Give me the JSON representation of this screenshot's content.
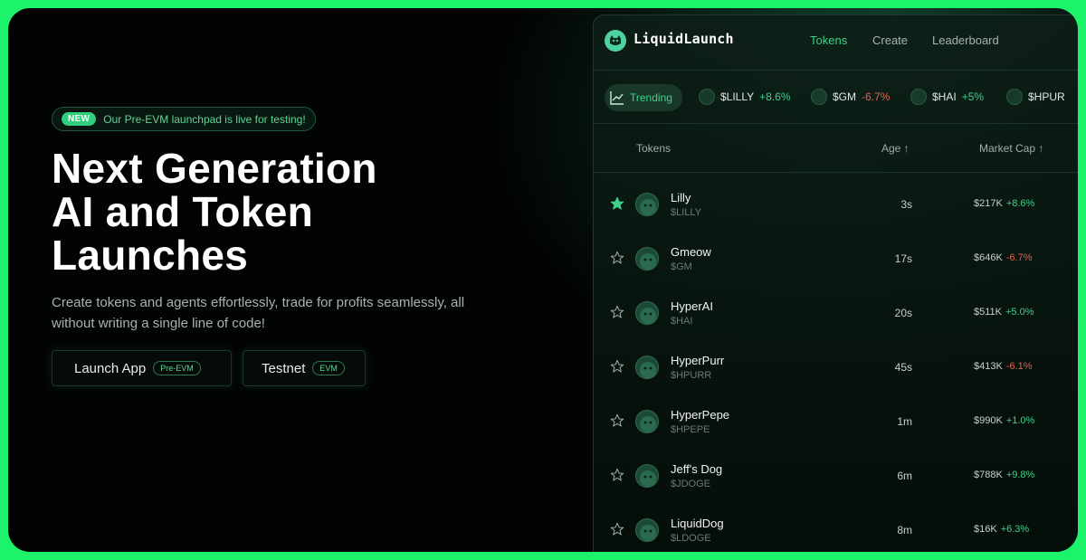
{
  "hero": {
    "badge_tag": "NEW",
    "badge_text": "Our Pre-EVM launchpad is live for testing!",
    "title_lines": [
      "Next Generation",
      "AI and Token",
      "Launches"
    ],
    "subtitle": "Create tokens and agents effortlessly, trade for profits seamlessly, all without writing a single line of code!",
    "launch_button": "Launch App",
    "launch_pill": "Pre-EVM",
    "testnet_button": "Testnet",
    "testnet_pill": "EVM"
  },
  "app": {
    "logo_text": "LiquidLaunch",
    "nav": [
      {
        "label": "Tokens",
        "active": true
      },
      {
        "label": "Create",
        "active": false
      },
      {
        "label": "Leaderboard",
        "active": false
      }
    ],
    "trending_label": "Trending",
    "ticker": [
      {
        "symbol": "$LILLY",
        "change": "+8.6%",
        "dir": "up"
      },
      {
        "symbol": "$GM",
        "change": "-6.7%",
        "dir": "down"
      },
      {
        "symbol": "$HAI",
        "change": "+5%",
        "dir": "up"
      },
      {
        "symbol": "$HPUR",
        "change": "",
        "dir": "up"
      }
    ],
    "table_headers": {
      "tokens": "Tokens",
      "age": "Age ↑",
      "market_cap": "Market Cap ↑"
    },
    "rows": [
      {
        "name": "Lilly",
        "symbol": "$LILLY",
        "age": "3s",
        "cap": "$217K",
        "change": "+8.6%",
        "dir": "up",
        "starred": true
      },
      {
        "name": "Gmeow",
        "symbol": "$GM",
        "age": "17s",
        "cap": "$646K",
        "change": "-6.7%",
        "dir": "down",
        "starred": false
      },
      {
        "name": "HyperAI",
        "symbol": "$HAI",
        "age": "20s",
        "cap": "$511K",
        "change": "+5.0%",
        "dir": "up",
        "starred": false
      },
      {
        "name": "HyperPurr",
        "symbol": "$HPURR",
        "age": "45s",
        "cap": "$413K",
        "change": "-6.1%",
        "dir": "down",
        "starred": false
      },
      {
        "name": "HyperPepe",
        "symbol": "$HPEPE",
        "age": "1m",
        "cap": "$990K",
        "change": "+1.0%",
        "dir": "up",
        "starred": false
      },
      {
        "name": "Jeff's Dog",
        "symbol": "$JDOGE",
        "age": "6m",
        "cap": "$788K",
        "change": "+9.8%",
        "dir": "up",
        "starred": false
      },
      {
        "name": "LiquidDog",
        "symbol": "$LDOGE",
        "age": "8m",
        "cap": "$16K",
        "change": "+6.3%",
        "dir": "up",
        "starred": false
      }
    ]
  },
  "colors": {
    "accent": "#3fd08a",
    "negative": "#e2634c",
    "frame": "#1df36a"
  }
}
